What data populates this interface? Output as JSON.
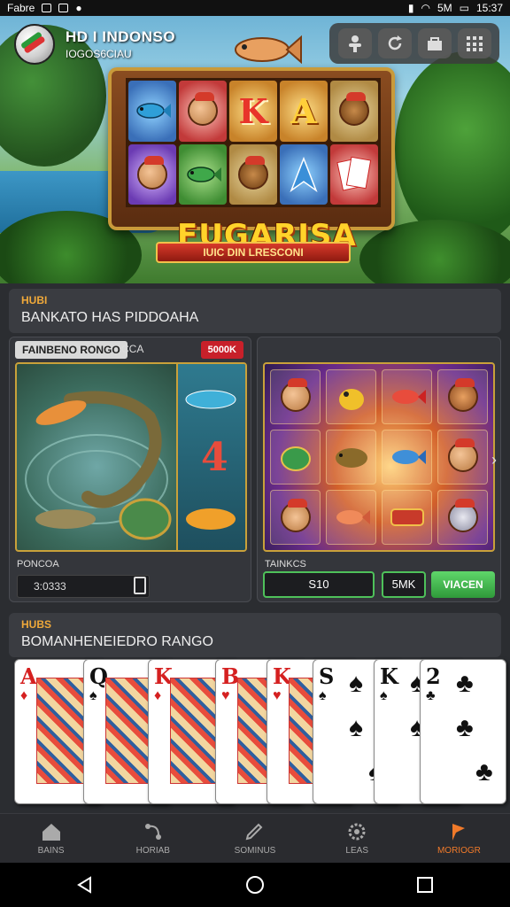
{
  "status_bar": {
    "left_text": "Fabre",
    "right_text": "15:37",
    "network": "5M"
  },
  "header": {
    "app_title": "HD I INDONSO",
    "app_subtitle": "IOGOS6CIAU",
    "toolbar_icons": [
      "character-icon",
      "refresh-icon",
      "shop-icon",
      "grid-icon"
    ]
  },
  "hero": {
    "brand": "FUGARISA",
    "ribbon": "IUIC DIN LRESCONI",
    "reel_letters": [
      "K",
      "A"
    ]
  },
  "section1": {
    "kicker": "HUBI",
    "title": "BANKATO HAS PIDDOAHA"
  },
  "panel1": {
    "tag": "FAINBENO RONGO",
    "tag2": "CCA",
    "badge": "5000K",
    "label": "PONCOA",
    "field_value": "3:0333"
  },
  "panel2": {
    "label": "TAINKCS",
    "value_box1": "S10",
    "value_box2": "5MK",
    "action_button": "VIACEN"
  },
  "section2": {
    "kicker": "HUBS",
    "title": "BOMANHENEIEDRO RANGO"
  },
  "cards": [
    {
      "rank": "A",
      "suit": "♦",
      "color": "red",
      "face": true
    },
    {
      "rank": "Q",
      "suit": "♠",
      "color": "black",
      "face": true
    },
    {
      "rank": "K",
      "suit": "♦",
      "color": "red",
      "face": true
    },
    {
      "rank": "B",
      "suit": "♥",
      "color": "red",
      "face": true
    },
    {
      "rank": "K",
      "suit": "♥",
      "color": "red",
      "face": true
    },
    {
      "rank": "S",
      "suit": "♠",
      "color": "black",
      "face": false
    },
    {
      "rank": "K",
      "suit": "♠",
      "color": "black",
      "face": false
    },
    {
      "rank": "2",
      "suit": "♣",
      "color": "black",
      "face": false
    }
  ],
  "nav": [
    {
      "label": "BAINS",
      "icon": "home-icon",
      "active": false
    },
    {
      "label": "HORIAB",
      "icon": "share-icon",
      "active": false
    },
    {
      "label": "SOMINUS",
      "icon": "pen-icon",
      "active": false
    },
    {
      "label": "LEAS",
      "icon": "gear-icon",
      "active": false
    },
    {
      "label": "MORIOGR",
      "icon": "flag-icon",
      "active": true
    }
  ],
  "colors": {
    "accent": "#f07a2a",
    "badge": "#c8202a",
    "green": "#4ec15a"
  }
}
